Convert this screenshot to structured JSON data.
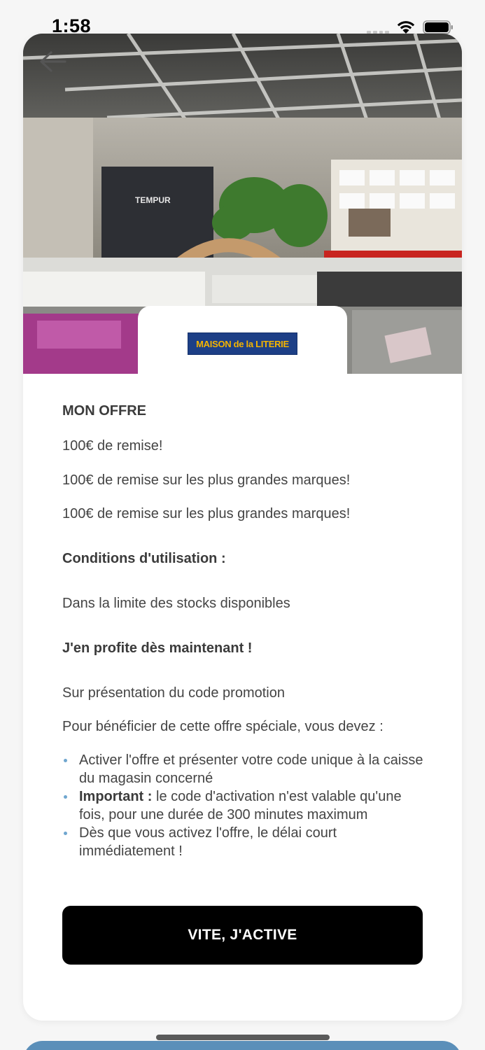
{
  "status_bar": {
    "time": "1:58"
  },
  "brand": {
    "name": "MAISON de la LITERIE",
    "logo_color": "#1d3f86",
    "logo_text_color": "#f4b400"
  },
  "offer": {
    "section_title": "MON OFFRE",
    "lines": [
      "100€ de remise!",
      "100€ de remise sur les plus grandes marques!",
      "100€ de remise sur les plus grandes marques!"
    ],
    "conditions_title": "Conditions d'utilisation :",
    "conditions_text": "Dans la limite des stocks disponibles",
    "profite_title": "J'en profite dès maintenant !",
    "presentation_text": "Sur présentation du code promotion",
    "intro_text": "Pour bénéficier de cette offre spéciale, vous devez :",
    "bullets": [
      {
        "bold": "",
        "text": "Activer l'offre et présenter votre code unique à la caisse du magasin concerné"
      },
      {
        "bold": "Important :",
        "text": " le code d'activation n'est valable qu'une fois, pour une durée de 300 minutes maximum"
      },
      {
        "bold": "",
        "text": "Dès que vous activez l'offre, le délai court immédiatement !"
      }
    ]
  },
  "cta": {
    "label": "VITE, J'ACTIVE"
  },
  "colors": {
    "button_bg": "#000000",
    "bullet": "#6fa6cf",
    "next_card": "#5b8fb9"
  },
  "icons": {
    "back": "back-arrow-icon",
    "wifi": "wifi-icon",
    "battery": "battery-icon",
    "signal": "signal-icon"
  }
}
